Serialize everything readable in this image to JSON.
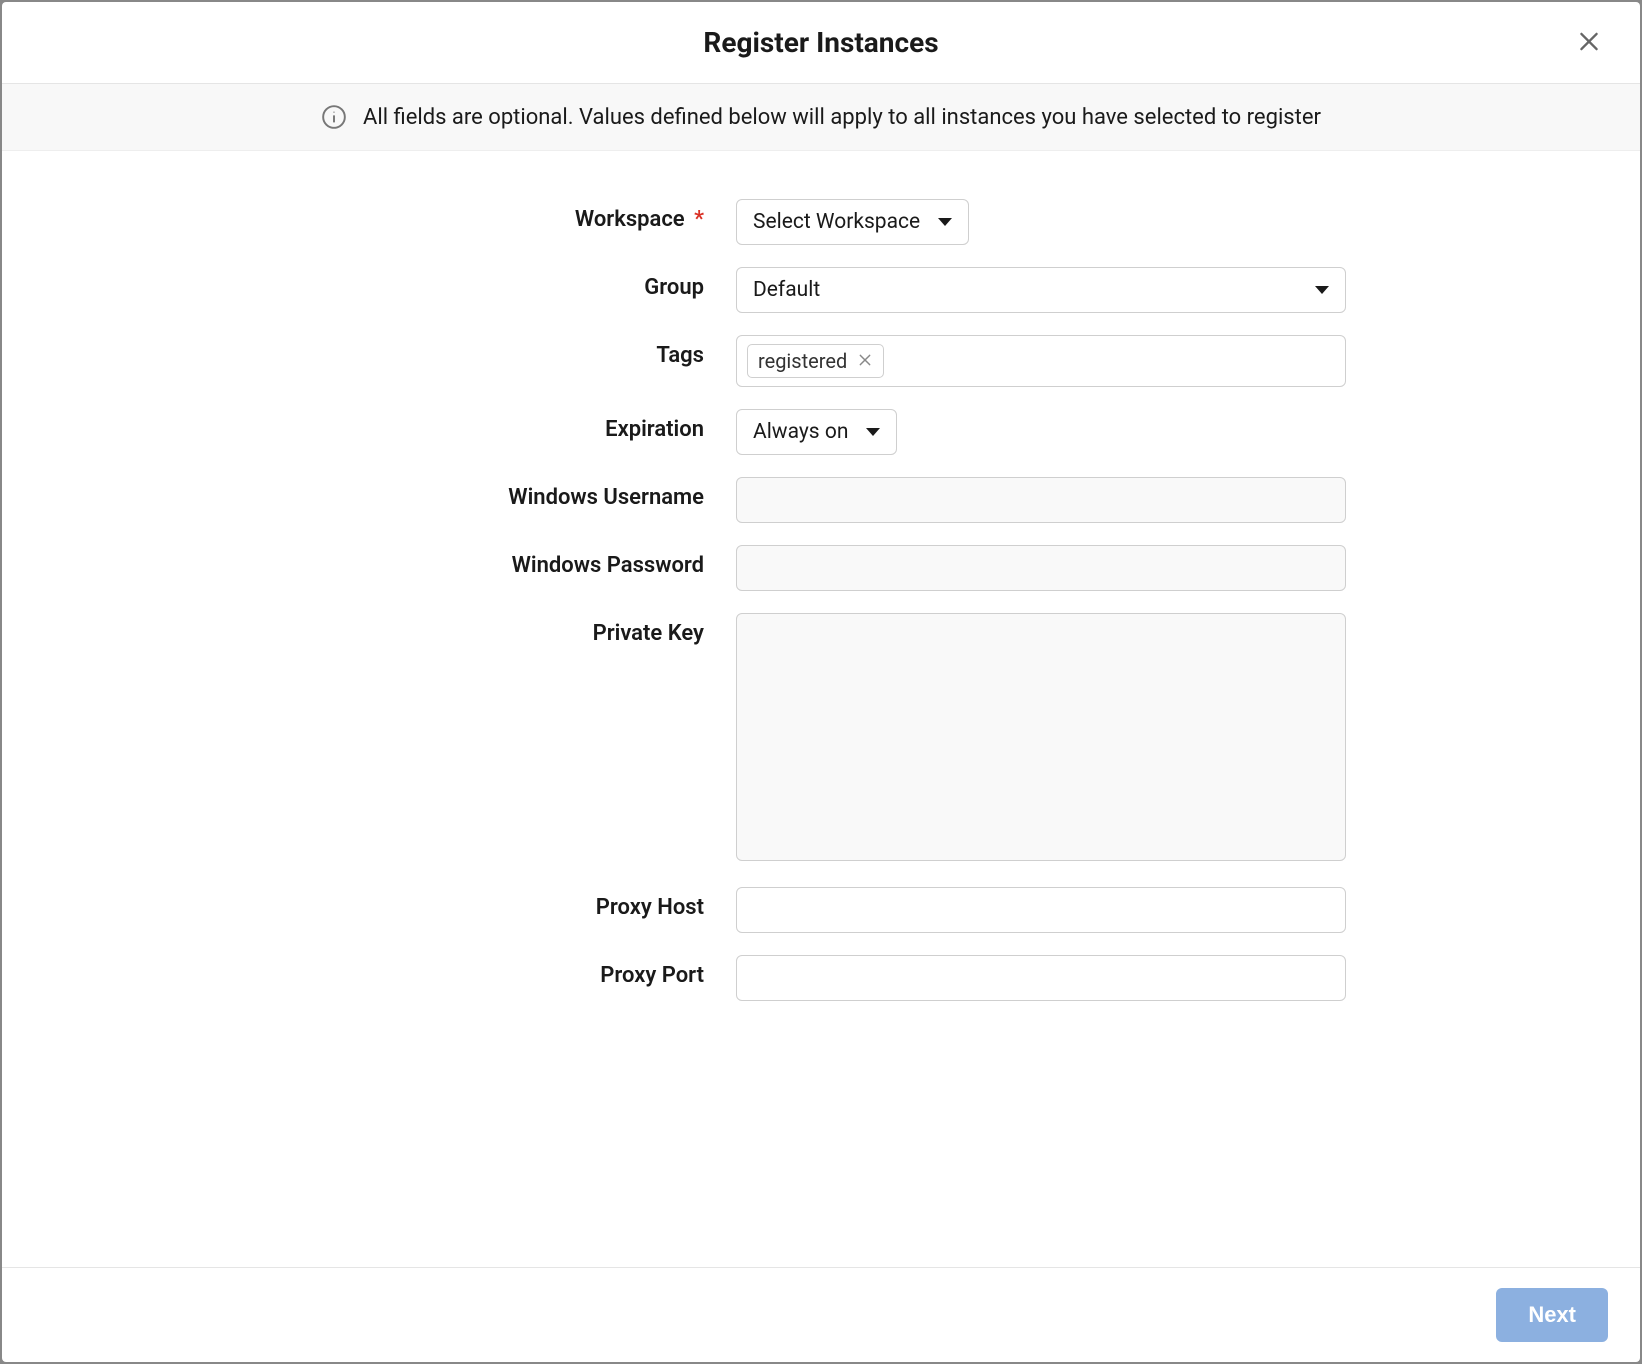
{
  "dialog": {
    "title": "Register Instances"
  },
  "banner": {
    "text": "All fields are optional. Values defined below will apply to all instances you have selected to register"
  },
  "form": {
    "workspace": {
      "label": "Workspace",
      "required_marker": "*",
      "selected": "Select Workspace"
    },
    "group": {
      "label": "Group",
      "selected": "Default"
    },
    "tags": {
      "label": "Tags",
      "values": [
        "registered"
      ]
    },
    "expiration": {
      "label": "Expiration",
      "selected": "Always on"
    },
    "windows_username": {
      "label": "Windows Username",
      "value": ""
    },
    "windows_password": {
      "label": "Windows Password",
      "value": ""
    },
    "private_key": {
      "label": "Private Key",
      "value": ""
    },
    "proxy_host": {
      "label": "Proxy Host",
      "value": ""
    },
    "proxy_port": {
      "label": "Proxy Port",
      "value": ""
    }
  },
  "footer": {
    "next_label": "Next"
  }
}
